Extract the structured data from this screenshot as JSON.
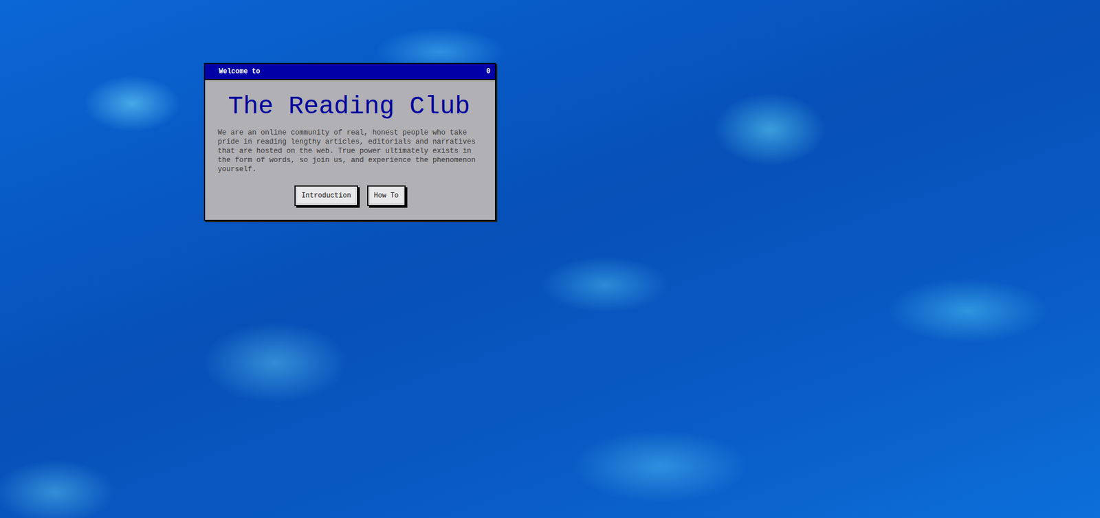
{
  "window": {
    "title": "Welcome to",
    "counter": "0"
  },
  "heading": "The Reading Club",
  "description": "We are an online community of real, honest people who take pride in reading lengthy articles, editorials and narratives that are hosted on the web. True power ultimately exists in the form of words, so join us, and experience the phenomenon yourself.",
  "buttons": [
    "Introduction",
    "How To"
  ]
}
